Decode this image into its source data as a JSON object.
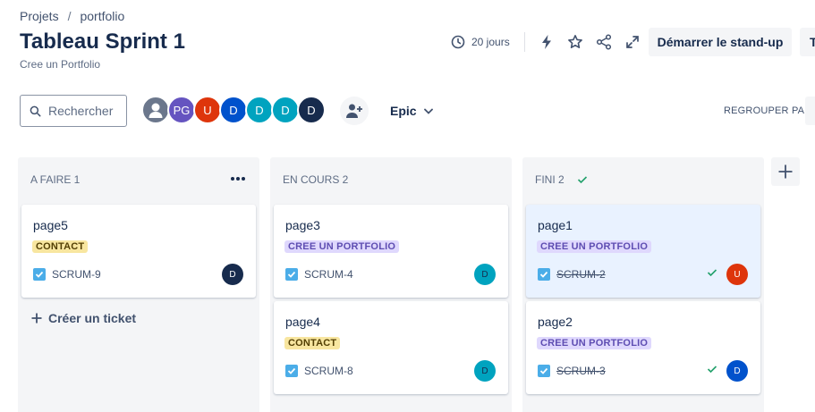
{
  "breadcrumb": {
    "project": "Projets",
    "separator": "/",
    "current": "portfolio"
  },
  "board": {
    "title": "Tableau Sprint 1",
    "subtitle": "Cree un Portfolio"
  },
  "toolbar": {
    "days_remaining": "20 jours",
    "standup_label": "Démarrer le stand-up",
    "truncated_button": "T",
    "icons": [
      "clock-icon",
      "lightning-icon",
      "star-icon",
      "share-icon",
      "expand-icon"
    ]
  },
  "filters": {
    "search_placeholder": "Rechercher",
    "epic_label": "Epic",
    "group_by_label": "REGROUPER PAR",
    "avatars": [
      {
        "initials": "",
        "color": "#6b778c",
        "icon": "default-user-icon"
      },
      {
        "initials": "PG",
        "color": "#6554c0"
      },
      {
        "initials": "U",
        "color": "#de350b"
      },
      {
        "initials": "D",
        "color": "#0052cc"
      },
      {
        "initials": "D",
        "color": "#00a3bf"
      },
      {
        "initials": "D",
        "color": "#00a3bf"
      },
      {
        "initials": "D",
        "color": "#172b4d"
      }
    ]
  },
  "columns": [
    {
      "title": "A FAIRE 1",
      "create_label": "Créer un ticket",
      "cards": [
        {
          "title": "page5",
          "label": "CONTACT",
          "label_type": "contact",
          "key": "SCRUM-9",
          "done": false,
          "assignee": "D",
          "assignee_color": "#172b4d"
        }
      ]
    },
    {
      "title": "EN COURS 2",
      "cards": [
        {
          "title": "page3",
          "label": "CREE UN PORTFOLIO",
          "label_type": "portfolio",
          "key": "SCRUM-4",
          "done": false,
          "assignee": "D",
          "assignee_color": "#00a3bf"
        },
        {
          "title": "page4",
          "label": "CONTACT",
          "label_type": "contact",
          "key": "SCRUM-8",
          "done": false,
          "assignee": "D",
          "assignee_color": "#00a3bf"
        }
      ]
    },
    {
      "title": "FINI 2",
      "cards": [
        {
          "title": "page1",
          "label": "CREE UN PORTFOLIO",
          "label_type": "portfolio",
          "key": "SCRUM-2",
          "done": true,
          "assignee": "U",
          "assignee_color": "#de350b",
          "selected": true
        },
        {
          "title": "page2",
          "label": "CREE UN PORTFOLIO",
          "label_type": "portfolio",
          "key": "SCRUM-3",
          "done": true,
          "assignee": "D",
          "assignee_color": "#0052cc"
        }
      ]
    }
  ],
  "colors": {
    "accent": "#0052cc",
    "done_check": "#22a06b",
    "column_bg": "#f4f5f7"
  }
}
